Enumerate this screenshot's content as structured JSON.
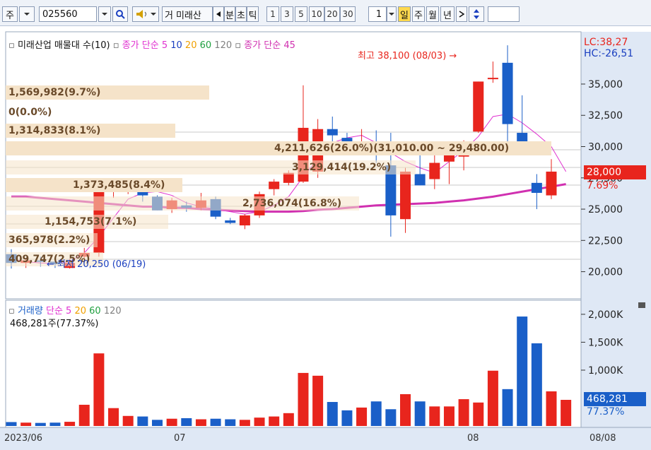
{
  "toolbar": {
    "market": "주",
    "code": "025560",
    "name": "미래산",
    "name_prefix": "거",
    "periods": [
      "분",
      "초",
      "틱"
    ],
    "numbers": [
      "1",
      "3",
      "5",
      "10",
      "20",
      "30"
    ],
    "interval_value": "1",
    "period_tabs": [
      "일",
      "주",
      "월",
      "년"
    ],
    "period_selected": "일"
  },
  "legend": {
    "title": "미래산업 매물대 수(10)",
    "ma_label": "종가 단순",
    "ma_periods": [
      "5",
      "10",
      "20",
      "60",
      "120"
    ],
    "ma45_label": "종가 단순 45",
    "lc": "LC:38,27",
    "hc": "HC:-26,51"
  },
  "price_panel": {
    "high_label": "최고 38,100 (08/03)",
    "low_label": "최저 20,250 (06/19)",
    "current_price": "28,000",
    "current_change": "7.69%",
    "y_ticks": [
      "35,000",
      "32,500",
      "30,000",
      "27,500",
      "25,000",
      "22,500",
      "20,000"
    ],
    "current_y_label": "28,000",
    "volume_profile": [
      {
        "text": "1,569,982(9.7%)"
      },
      {
        "text": "0(0.0%)"
      },
      {
        "text": "1,314,833(8.1%)"
      },
      {
        "text": "4,211,626(26.0%)(31,010.00 ~ 29,480.00)"
      },
      {
        "text": "3,129,414(19.2%)"
      },
      {
        "text": "1,373,485(8.4%)"
      },
      {
        "text": "2,736,074(16.8%)"
      },
      {
        "text": "1,154,753(7.1%)"
      },
      {
        "text": "365,978(2.2%)"
      },
      {
        "text": "409,747(2.5%)"
      }
    ]
  },
  "volume_panel": {
    "title": "거래량",
    "ma_label": "단순",
    "ma_periods": [
      "5",
      "20",
      "60",
      "120"
    ],
    "current_volume": "468,281주(77.37%)",
    "y_ticks": [
      "2,000K",
      "1,500K",
      "1,000K"
    ],
    "current_box": "468,281",
    "current_pct": "77.37%"
  },
  "x_axis": {
    "labels": [
      "2023/06",
      "07",
      "08"
    ],
    "right_date": "08/08"
  },
  "colors": {
    "up": "#e8251d",
    "down": "#1a5fc8",
    "ma5": "#e030d0",
    "ma10": "#1a3fc0",
    "ma20": "#f0a000",
    "ma60": "#20a040",
    "ma120": "#808080",
    "ma45": "#d030b0"
  },
  "chart_data": {
    "type": "candlestick",
    "candles": [
      {
        "o": 21400,
        "h": 21800,
        "l": 20250,
        "c": 20700
      },
      {
        "o": 20700,
        "h": 21100,
        "l": 20300,
        "c": 20900
      },
      {
        "o": 20900,
        "h": 21200,
        "l": 20400,
        "c": 20800
      },
      {
        "o": 20800,
        "h": 21000,
        "l": 20300,
        "c": 20600
      },
      {
        "o": 20300,
        "h": 21000,
        "l": 20250,
        "c": 20700
      },
      {
        "o": 21200,
        "h": 21900,
        "l": 20800,
        "c": 21500
      },
      {
        "o": 21500,
        "h": 27200,
        "l": 21200,
        "c": 26400
      },
      {
        "o": 26400,
        "h": 27300,
        "l": 25900,
        "c": 26800
      },
      {
        "o": 26800,
        "h": 27300,
        "l": 26200,
        "c": 26900
      },
      {
        "o": 26900,
        "h": 27200,
        "l": 25600,
        "c": 26100
      },
      {
        "o": 26000,
        "h": 26100,
        "l": 24900,
        "c": 24900
      },
      {
        "o": 25000,
        "h": 25900,
        "l": 24700,
        "c": 25700
      },
      {
        "o": 25300,
        "h": 25600,
        "l": 24800,
        "c": 25100
      },
      {
        "o": 25100,
        "h": 26300,
        "l": 24900,
        "c": 25700
      },
      {
        "o": 25800,
        "h": 26000,
        "l": 24200,
        "c": 24400
      },
      {
        "o": 24100,
        "h": 24300,
        "l": 23800,
        "c": 23900
      },
      {
        "o": 23700,
        "h": 24600,
        "l": 23400,
        "c": 24500
      },
      {
        "o": 24500,
        "h": 26400,
        "l": 24300,
        "c": 26200
      },
      {
        "o": 26600,
        "h": 27400,
        "l": 26100,
        "c": 27200
      },
      {
        "o": 27100,
        "h": 28100,
        "l": 26900,
        "c": 27900
      },
      {
        "o": 27200,
        "h": 34900,
        "l": 27100,
        "c": 31500
      },
      {
        "o": 28000,
        "h": 32200,
        "l": 27500,
        "c": 31400
      },
      {
        "o": 31400,
        "h": 32400,
        "l": 30200,
        "c": 30900
      },
      {
        "o": 30700,
        "h": 31100,
        "l": 30200,
        "c": 30300
      },
      {
        "o": 30300,
        "h": 31400,
        "l": 29800,
        "c": 30400
      },
      {
        "o": 30400,
        "h": 31300,
        "l": 28700,
        "c": 29300
      },
      {
        "o": 28500,
        "h": 31100,
        "l": 22800,
        "c": 24500
      },
      {
        "o": 24200,
        "h": 28300,
        "l": 23100,
        "c": 28000
      },
      {
        "o": 27800,
        "h": 29300,
        "l": 26900,
        "c": 26900
      },
      {
        "o": 27400,
        "h": 29500,
        "l": 26600,
        "c": 28700
      },
      {
        "o": 28800,
        "h": 29700,
        "l": 27000,
        "c": 29600
      },
      {
        "o": 29200,
        "h": 30500,
        "l": 28100,
        "c": 30400
      },
      {
        "o": 31200,
        "h": 35200,
        "l": 31100,
        "c": 35200
      },
      {
        "o": 35400,
        "h": 36800,
        "l": 35100,
        "c": 35500
      },
      {
        "o": 36700,
        "h": 38100,
        "l": 29600,
        "c": 31800
      },
      {
        "o": 31100,
        "h": 34100,
        "l": 29800,
        "c": 29800
      },
      {
        "o": 27100,
        "h": 27800,
        "l": 25000,
        "c": 26300
      },
      {
        "o": 26100,
        "h": 29000,
        "l": 25800,
        "c": 28000
      }
    ],
    "volumes": [
      70,
      60,
      55,
      60,
      75,
      380,
      1300,
      320,
      180,
      170,
      110,
      130,
      140,
      120,
      130,
      120,
      110,
      150,
      170,
      230,
      950,
      900,
      430,
      280,
      330,
      440,
      300,
      570,
      440,
      350,
      350,
      480,
      420,
      990,
      660,
      1960,
      1480,
      620,
      468
    ],
    "ma5": [
      21000,
      20800,
      20700,
      20650,
      20800,
      21500,
      22800,
      24300,
      25800,
      26300,
      26400,
      26100,
      25500,
      25200,
      25000,
      24800,
      24600,
      24800,
      25300,
      26000,
      27600,
      29000,
      30300,
      30700,
      30900,
      30300,
      29500,
      28800,
      28300,
      27900,
      28800,
      29700,
      30800,
      32400,
      32600,
      31900,
      31000,
      30000,
      28000
    ],
    "ma45": [
      26000,
      26000,
      25900,
      25800,
      25700,
      25600,
      25500,
      25400,
      25300,
      25200,
      25200,
      25100,
      25100,
      25000,
      24950,
      24900,
      24850,
      24800,
      24800,
      24800,
      24850,
      24950,
      25000,
      25100,
      25200,
      25300,
      25350,
      25400,
      25450,
      25500,
      25600,
      25700,
      25850,
      26000,
      26200,
      26400,
      26600,
      26800,
      27000
    ],
    "y_range": [
      18000,
      38500
    ],
    "vol_range": [
      0,
      2100
    ]
  }
}
